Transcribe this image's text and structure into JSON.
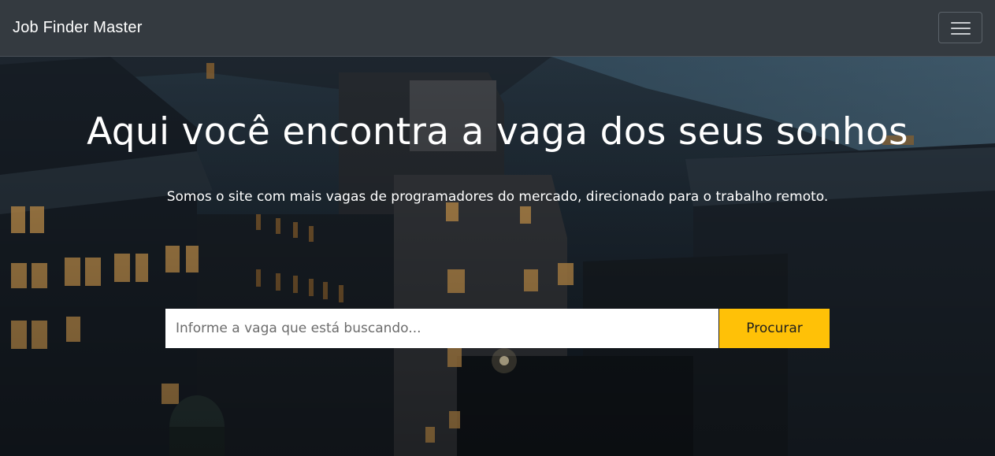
{
  "navbar": {
    "brand": "Job Finder Master",
    "toggler_icon": "hamburger-icon"
  },
  "hero": {
    "title": "Aqui você encontra a vaga dos seus sonhos",
    "subtitle": "Somos o site com mais vagas de programadores do mercado, direcionado para o trabalho remoto.",
    "background": "city-at-night-photo"
  },
  "search": {
    "placeholder": "Informe a vaga que está buscando...",
    "value": "",
    "button_label": "Procurar"
  },
  "colors": {
    "navbar_bg": "#343a40",
    "accent": "#ffc107",
    "text_light": "#ffffff"
  }
}
